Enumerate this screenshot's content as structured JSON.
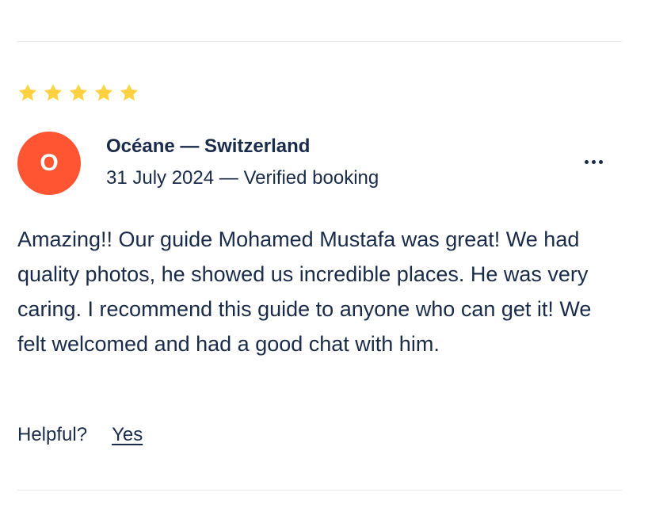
{
  "review": {
    "rating": 5,
    "rating_max": 5,
    "star_color": "#ffd23f",
    "avatar": {
      "initial": "O",
      "color": "#ff5533"
    },
    "author": "Océane — Switzerland",
    "meta": "31 July 2024 — Verified booking",
    "more_icon": "more-horizontal-icon",
    "text": "Amazing!! Our guide Mohamed Mustafa was great! We had quality photos, he showed us incredible places. He was very caring. I recommend this guide to anyone who can get it! We felt welcomed and had a good chat with him.",
    "helpful": {
      "label": "Helpful?",
      "yes_label": "Yes"
    }
  },
  "colors": {
    "text": "#1a2b49",
    "divider": "#e6e8ec"
  }
}
